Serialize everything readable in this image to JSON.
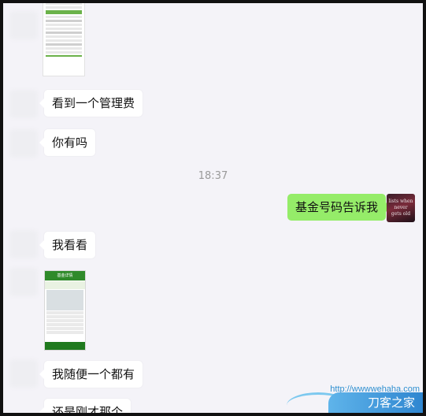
{
  "chat": {
    "messages_in": [
      {
        "text": "看到一个管理费"
      },
      {
        "text": "你有吗"
      },
      {
        "text": "我看看"
      },
      {
        "text": "我随便一个都有"
      },
      {
        "text": "还是刚才那个"
      }
    ],
    "timestamp": "18:37",
    "message_out": "基金号码告诉我"
  },
  "avatar": {
    "lines": [
      "lists when",
      "never",
      "gets old"
    ]
  },
  "thumb2": {
    "header": "基金详情"
  },
  "watermark": {
    "url": "http://wwwwehaha.com",
    "logo": "刀客之家"
  },
  "colors": {
    "out_bubble": "#95ec69",
    "in_bubble": "#ffffff",
    "bg": "#f4f3f8"
  }
}
